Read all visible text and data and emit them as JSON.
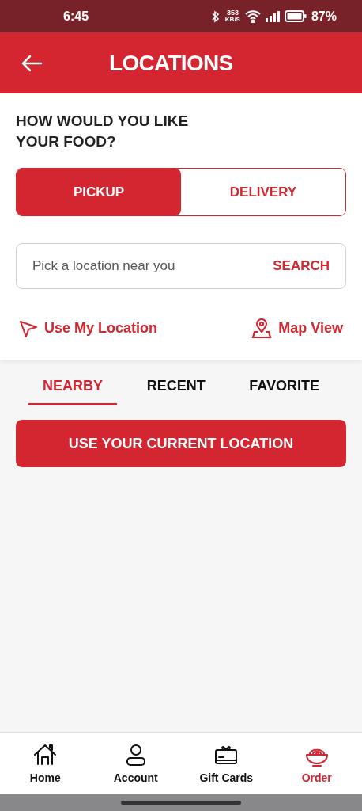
{
  "status_bar": {
    "time": "6:45",
    "speed": "353",
    "speed_unit": "KB/S",
    "battery": "87%"
  },
  "header": {
    "title": "LOCATIONS"
  },
  "question": "HOW WOULD YOU LIKE YOUR FOOD?",
  "modes": [
    {
      "label": "PICKUP",
      "selected": true
    },
    {
      "label": "DELIVERY",
      "selected": false
    }
  ],
  "search": {
    "placeholder": "Pick a location near you",
    "button": "SEARCH"
  },
  "links": [
    {
      "kind": "location",
      "label": "Use My Location"
    },
    {
      "kind": "map",
      "label": "Map View"
    }
  ],
  "tabs": [
    {
      "label": "NEARBY",
      "selected": true
    },
    {
      "label": "RECENT",
      "selected": false
    },
    {
      "label": "FAVORITE",
      "selected": false
    }
  ],
  "current_location_button": "USE YOUR CURRENT LOCATION",
  "nav": [
    {
      "kind": "home",
      "label": "Home",
      "selected": false
    },
    {
      "kind": "account",
      "label": "Account",
      "selected": false
    },
    {
      "kind": "gift",
      "label": "Gift Cards",
      "selected": false
    },
    {
      "kind": "order",
      "label": "Order",
      "selected": true
    }
  ]
}
